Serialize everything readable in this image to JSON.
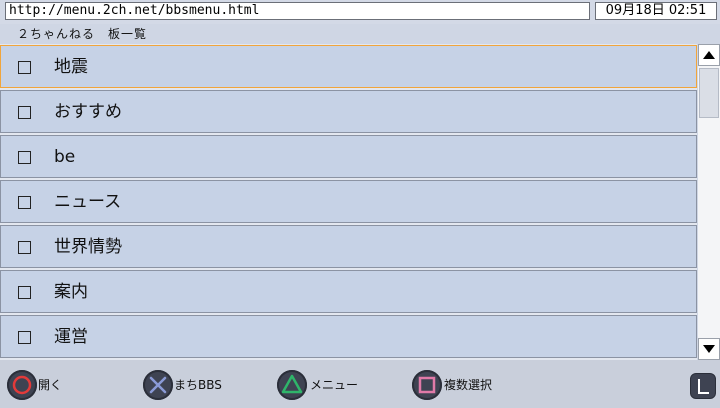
{
  "address_bar": {
    "url": "http://menu.2ch.net/bbsmenu.html"
  },
  "clock": {
    "text": "09月18日 02:51"
  },
  "page_title": "２ちゃんねる　板一覧",
  "list": {
    "items": [
      {
        "label": "地震",
        "selected": true
      },
      {
        "label": "おすすめ",
        "selected": false
      },
      {
        "label": "be",
        "selected": false
      },
      {
        "label": "ニュース",
        "selected": false
      },
      {
        "label": "世界情勢",
        "selected": false
      },
      {
        "label": "案内",
        "selected": false
      },
      {
        "label": "運営",
        "selected": false
      }
    ]
  },
  "scrollbar": {
    "up_icon": "triangle-up-icon",
    "down_icon": "triangle-down-icon"
  },
  "bottom_hints": [
    {
      "icon": "circle-button-icon",
      "label": "開く",
      "color": "#e23a3a"
    },
    {
      "icon": "cross-button-icon",
      "label": "まちBBS",
      "color": "#8a9ad6"
    },
    {
      "icon": "triangle-button-icon",
      "label": "メニュー",
      "color": "#2fb56a"
    },
    {
      "icon": "square-button-icon",
      "label": "複数選択",
      "color": "#e07aa8"
    }
  ],
  "corner_button": {
    "icon": "l-button-icon"
  },
  "colors": {
    "selection_border": "#f1a53b",
    "row_background": "#c6d2e6"
  }
}
